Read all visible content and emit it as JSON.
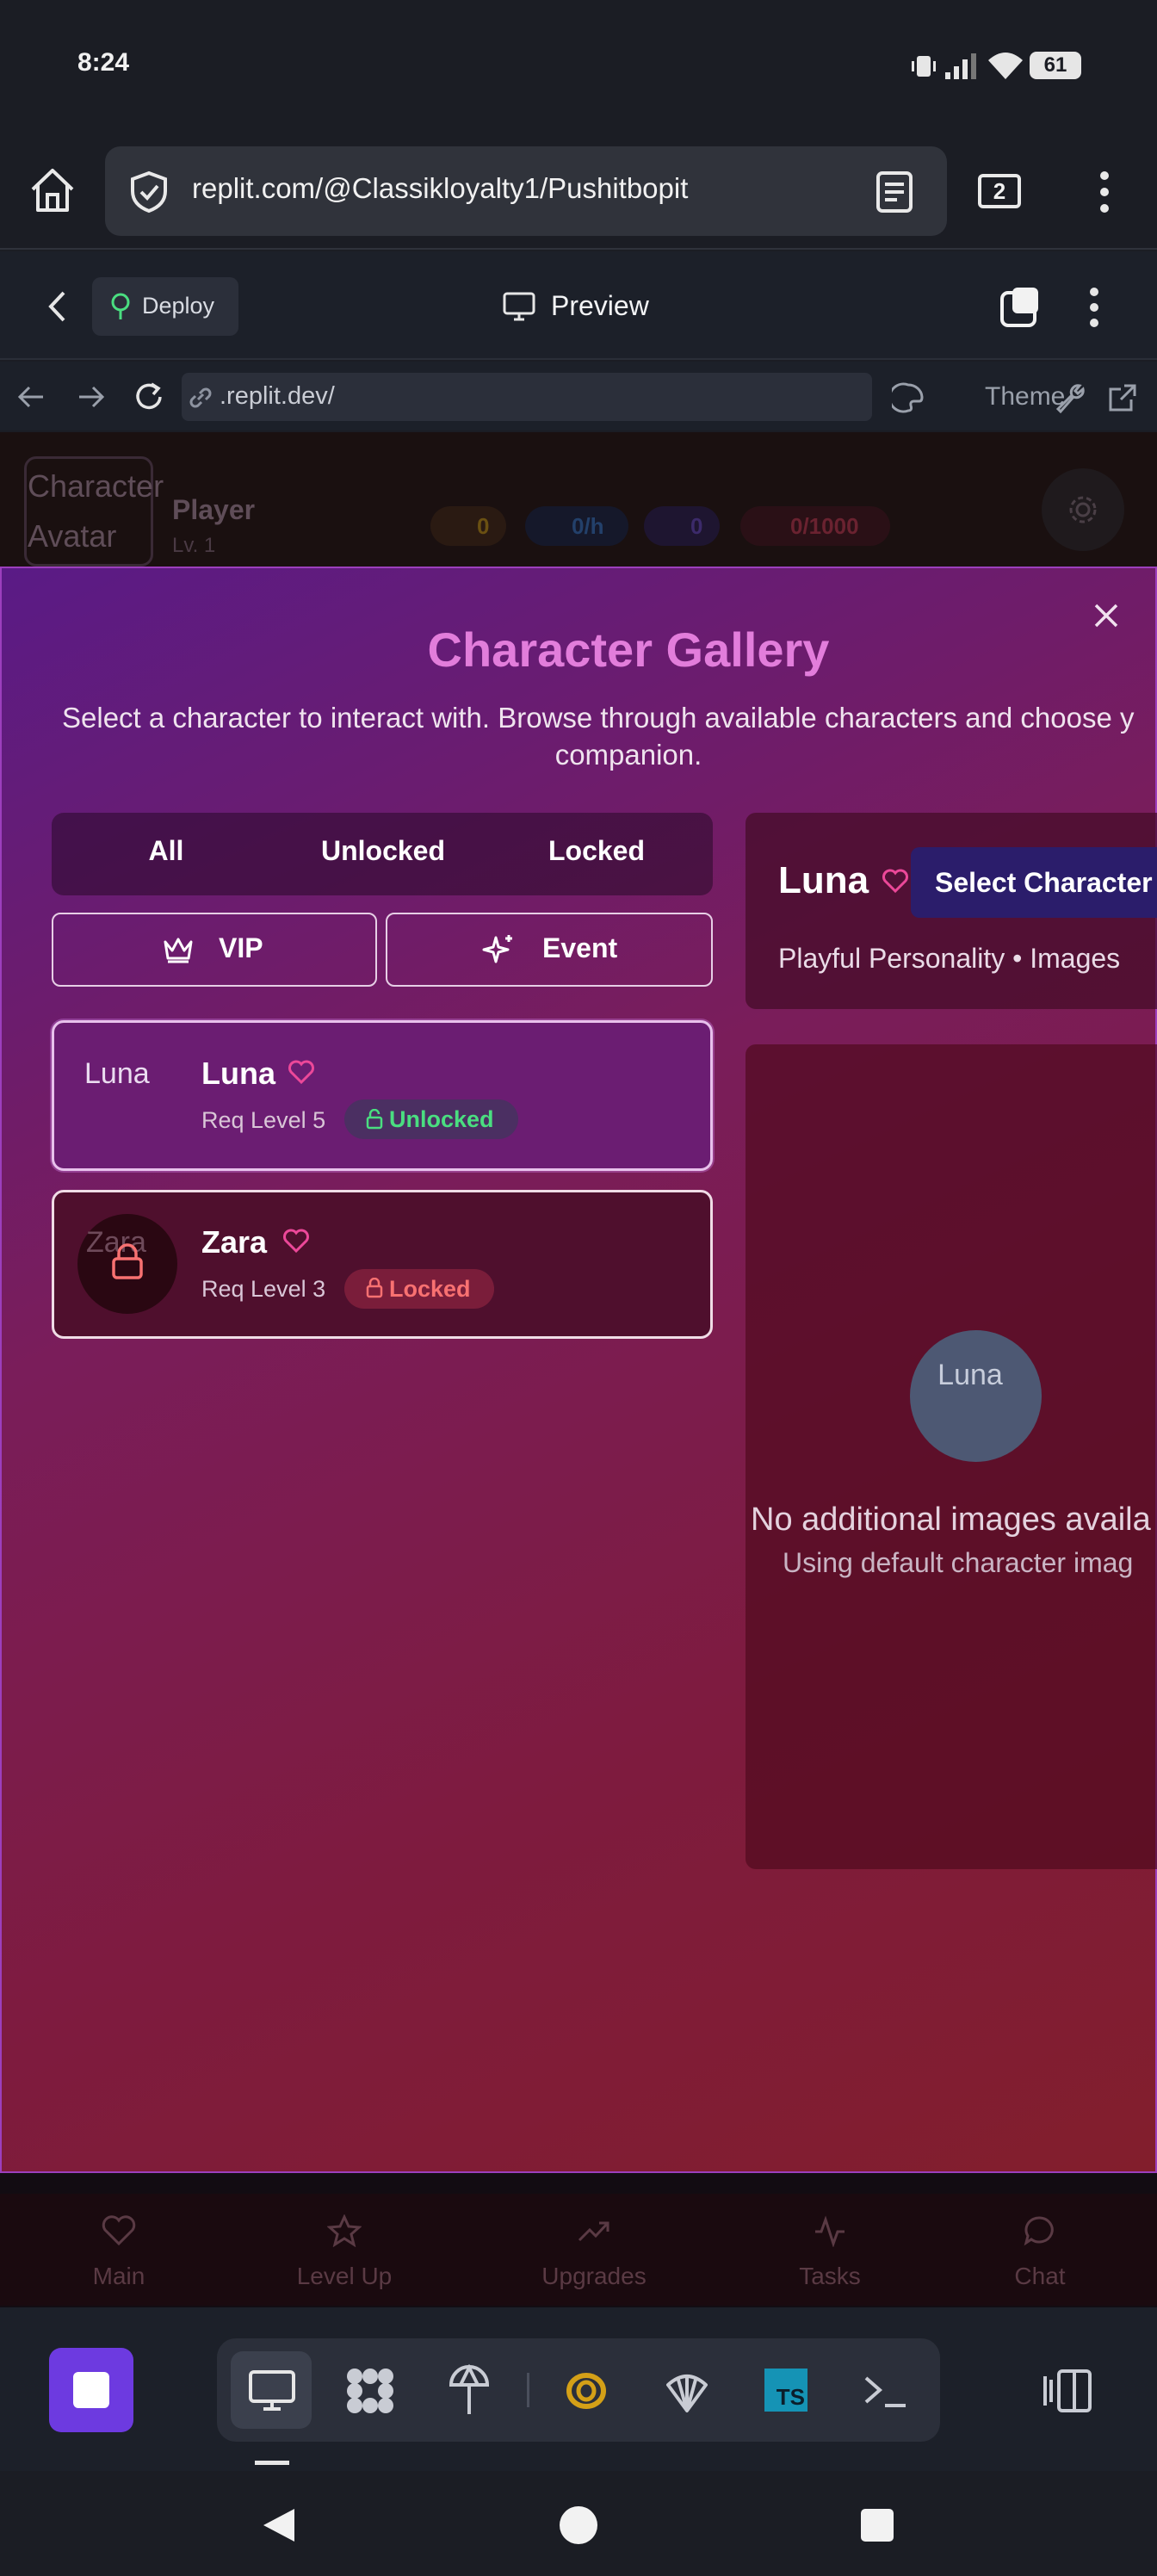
{
  "status_bar": {
    "time": "8:24",
    "battery": "61"
  },
  "browser": {
    "url": "replit.com/@Classikloyalty1/Pushitbopit",
    "tab_count": "2"
  },
  "replit_header": {
    "deploy_label": "Deploy",
    "preview_label": "Preview"
  },
  "preview_nav": {
    "url": ".replit.dev/",
    "theme_label": "Theme"
  },
  "app_topbar": {
    "avatar_text_1": "Character",
    "avatar_text_2": "Avatar",
    "player_name": "Player",
    "player_level": "Lv. 1",
    "stats": [
      "0",
      "0/h",
      "0",
      "0/1000"
    ]
  },
  "modal": {
    "title": "Character Gallery",
    "description_line1": "Select a character to interact with. Browse through available characters and choose y",
    "description_line2": "companion.",
    "filter_tabs": [
      "All",
      "Unlocked",
      "Locked"
    ],
    "filter_buttons": {
      "vip": "VIP",
      "event": "Event"
    },
    "characters": [
      {
        "avatar_text": "Luna",
        "name": "Luna",
        "req": "Req Level 5",
        "status": "Unlocked"
      },
      {
        "avatar_text": "Zara",
        "name": "Zara",
        "req": "Req Level 3",
        "status": "Locked"
      }
    ],
    "detail": {
      "name": "Luna",
      "select_label": "Select Character",
      "subtitle": "Playful Personality • Images",
      "avatar_text": "Luna",
      "no_images": "No additional images availa",
      "default_note": "Using default character imag"
    }
  },
  "app_nav": [
    "Main",
    "Level Up",
    "Upgrades",
    "Tasks",
    "Chat"
  ],
  "colors": {
    "title_pink": "#e27ddb",
    "unlocked_green": "#4ade80",
    "locked_red": "#f87171",
    "heart_pink": "#ec4899",
    "dock_purple": "#6d3ae0"
  }
}
